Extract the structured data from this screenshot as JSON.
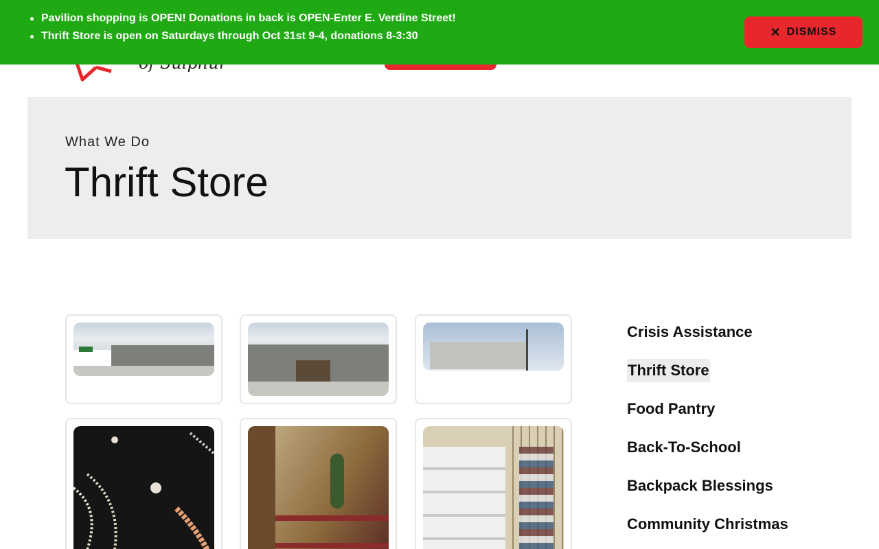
{
  "banner": {
    "items": [
      "Pavilion shopping is OPEN! Donations in back is OPEN-Enter E. Verdine Street!",
      "Thrift Store is open on Saturdays through Oct 31st 9-4, donations 8-3:30"
    ],
    "dismiss_label": "DISMISS",
    "background": "#1faa14",
    "button_color": "#e8272d"
  },
  "header": {
    "logo_text": "of Sulphur"
  },
  "hero": {
    "eyebrow": "What We Do",
    "title": "Thrift Store"
  },
  "sidebar": {
    "items": [
      {
        "label": "Crisis Assistance",
        "active": false
      },
      {
        "label": "Thrift Store",
        "active": true
      },
      {
        "label": "Food Pantry",
        "active": false
      },
      {
        "label": "Back-To-School",
        "active": false
      },
      {
        "label": "Backpack Blessings",
        "active": false
      },
      {
        "label": "Community Christmas",
        "active": false
      }
    ]
  },
  "gallery": {
    "photos": [
      {
        "name": "storefront-photo-1"
      },
      {
        "name": "storefront-photo-2"
      },
      {
        "name": "warehouse-photo"
      },
      {
        "name": "jewelry-photo"
      },
      {
        "name": "decor-shelves-photo"
      },
      {
        "name": "glassware-mugs-photo"
      }
    ]
  }
}
